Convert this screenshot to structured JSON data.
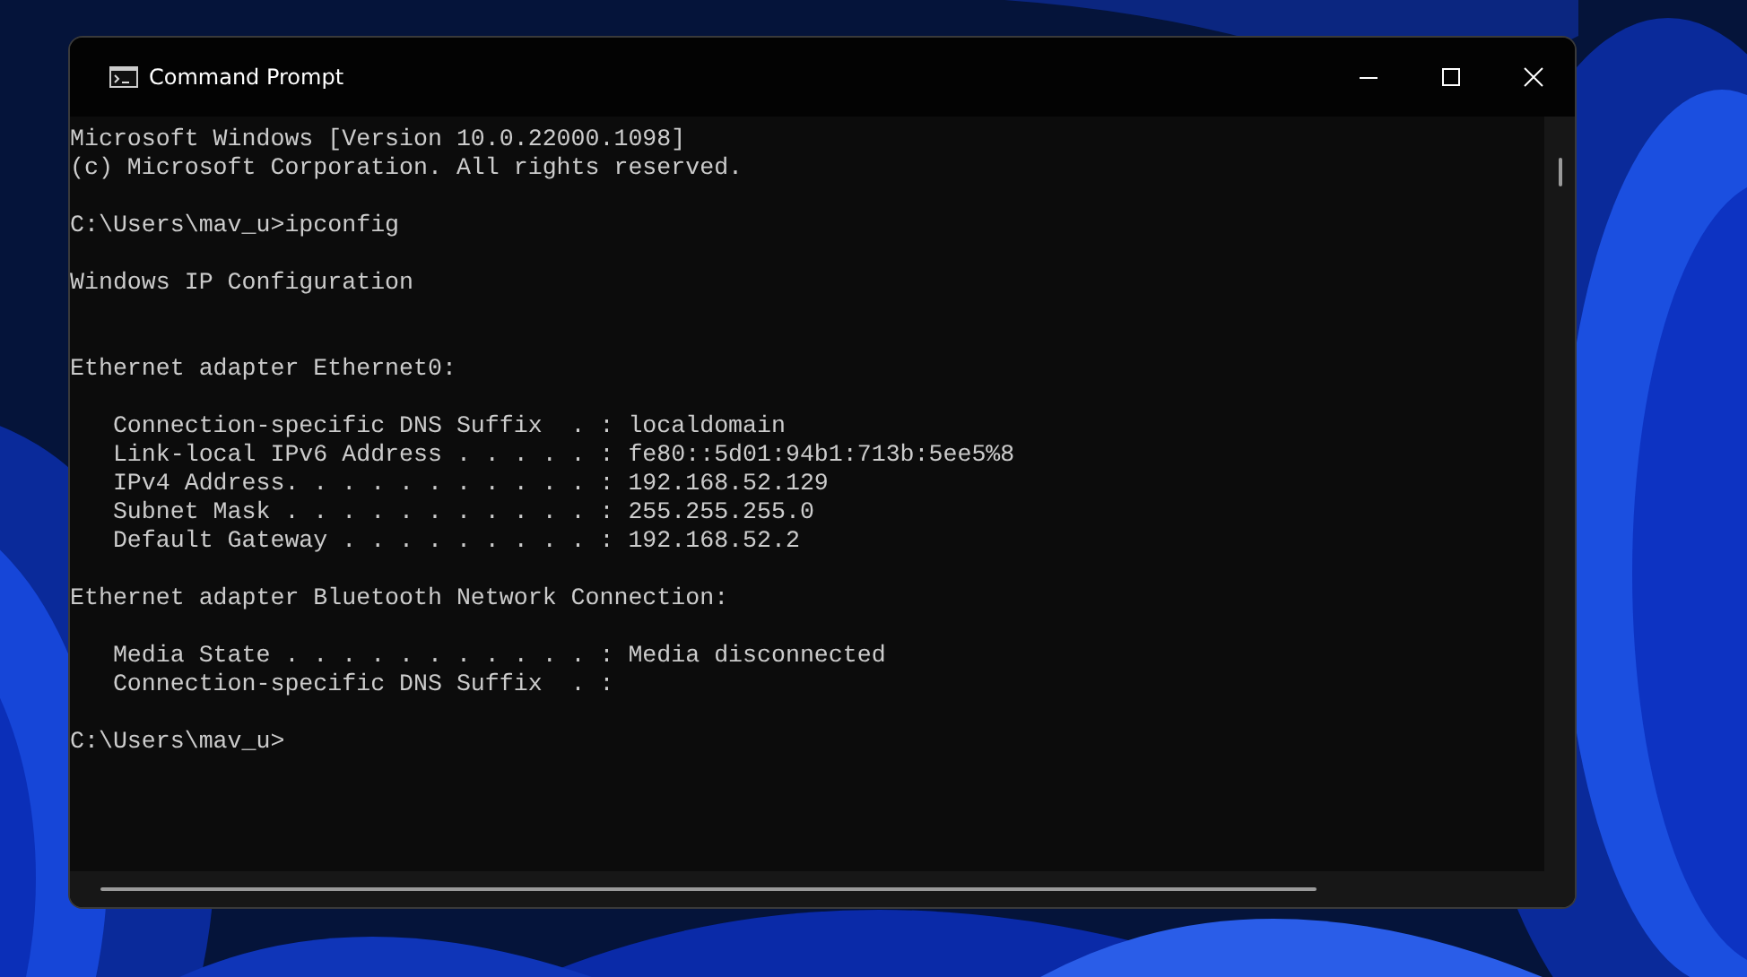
{
  "window": {
    "title": "Command Prompt"
  },
  "console": {
    "blocks": [
      {
        "kind": "text",
        "lines": [
          "Microsoft Windows [Version 10.0.22000.1098]",
          "(c) Microsoft Corporation. All rights reserved."
        ]
      },
      {
        "kind": "text",
        "lines": [
          "C:\\Users\\mav_u>ipconfig"
        ]
      },
      {
        "kind": "heading",
        "lines": [
          "Windows IP Configuration"
        ]
      },
      {
        "kind": "text",
        "lines": [
          "Ethernet adapter Ethernet0:"
        ]
      },
      {
        "kind": "text",
        "lines": [
          "   Connection-specific DNS Suffix  . : localdomain",
          "   Link-local IPv6 Address . . . . . : fe80::5d01:94b1:713b:5ee5%8",
          "   IPv4 Address. . . . . . . . . . . : 192.168.52.129",
          "   Subnet Mask . . . . . . . . . . . : 255.255.255.0",
          "   Default Gateway . . . . . . . . . : 192.168.52.2"
        ]
      },
      {
        "kind": "text",
        "lines": [
          "Ethernet adapter Bluetooth Network Connection:"
        ]
      },
      {
        "kind": "text",
        "lines": [
          "   Media State . . . . . . . . . . . : Media disconnected",
          "   Connection-specific DNS Suffix  . :"
        ]
      },
      {
        "kind": "text",
        "lines": [
          "C:\\Users\\mav_u>"
        ]
      }
    ]
  }
}
